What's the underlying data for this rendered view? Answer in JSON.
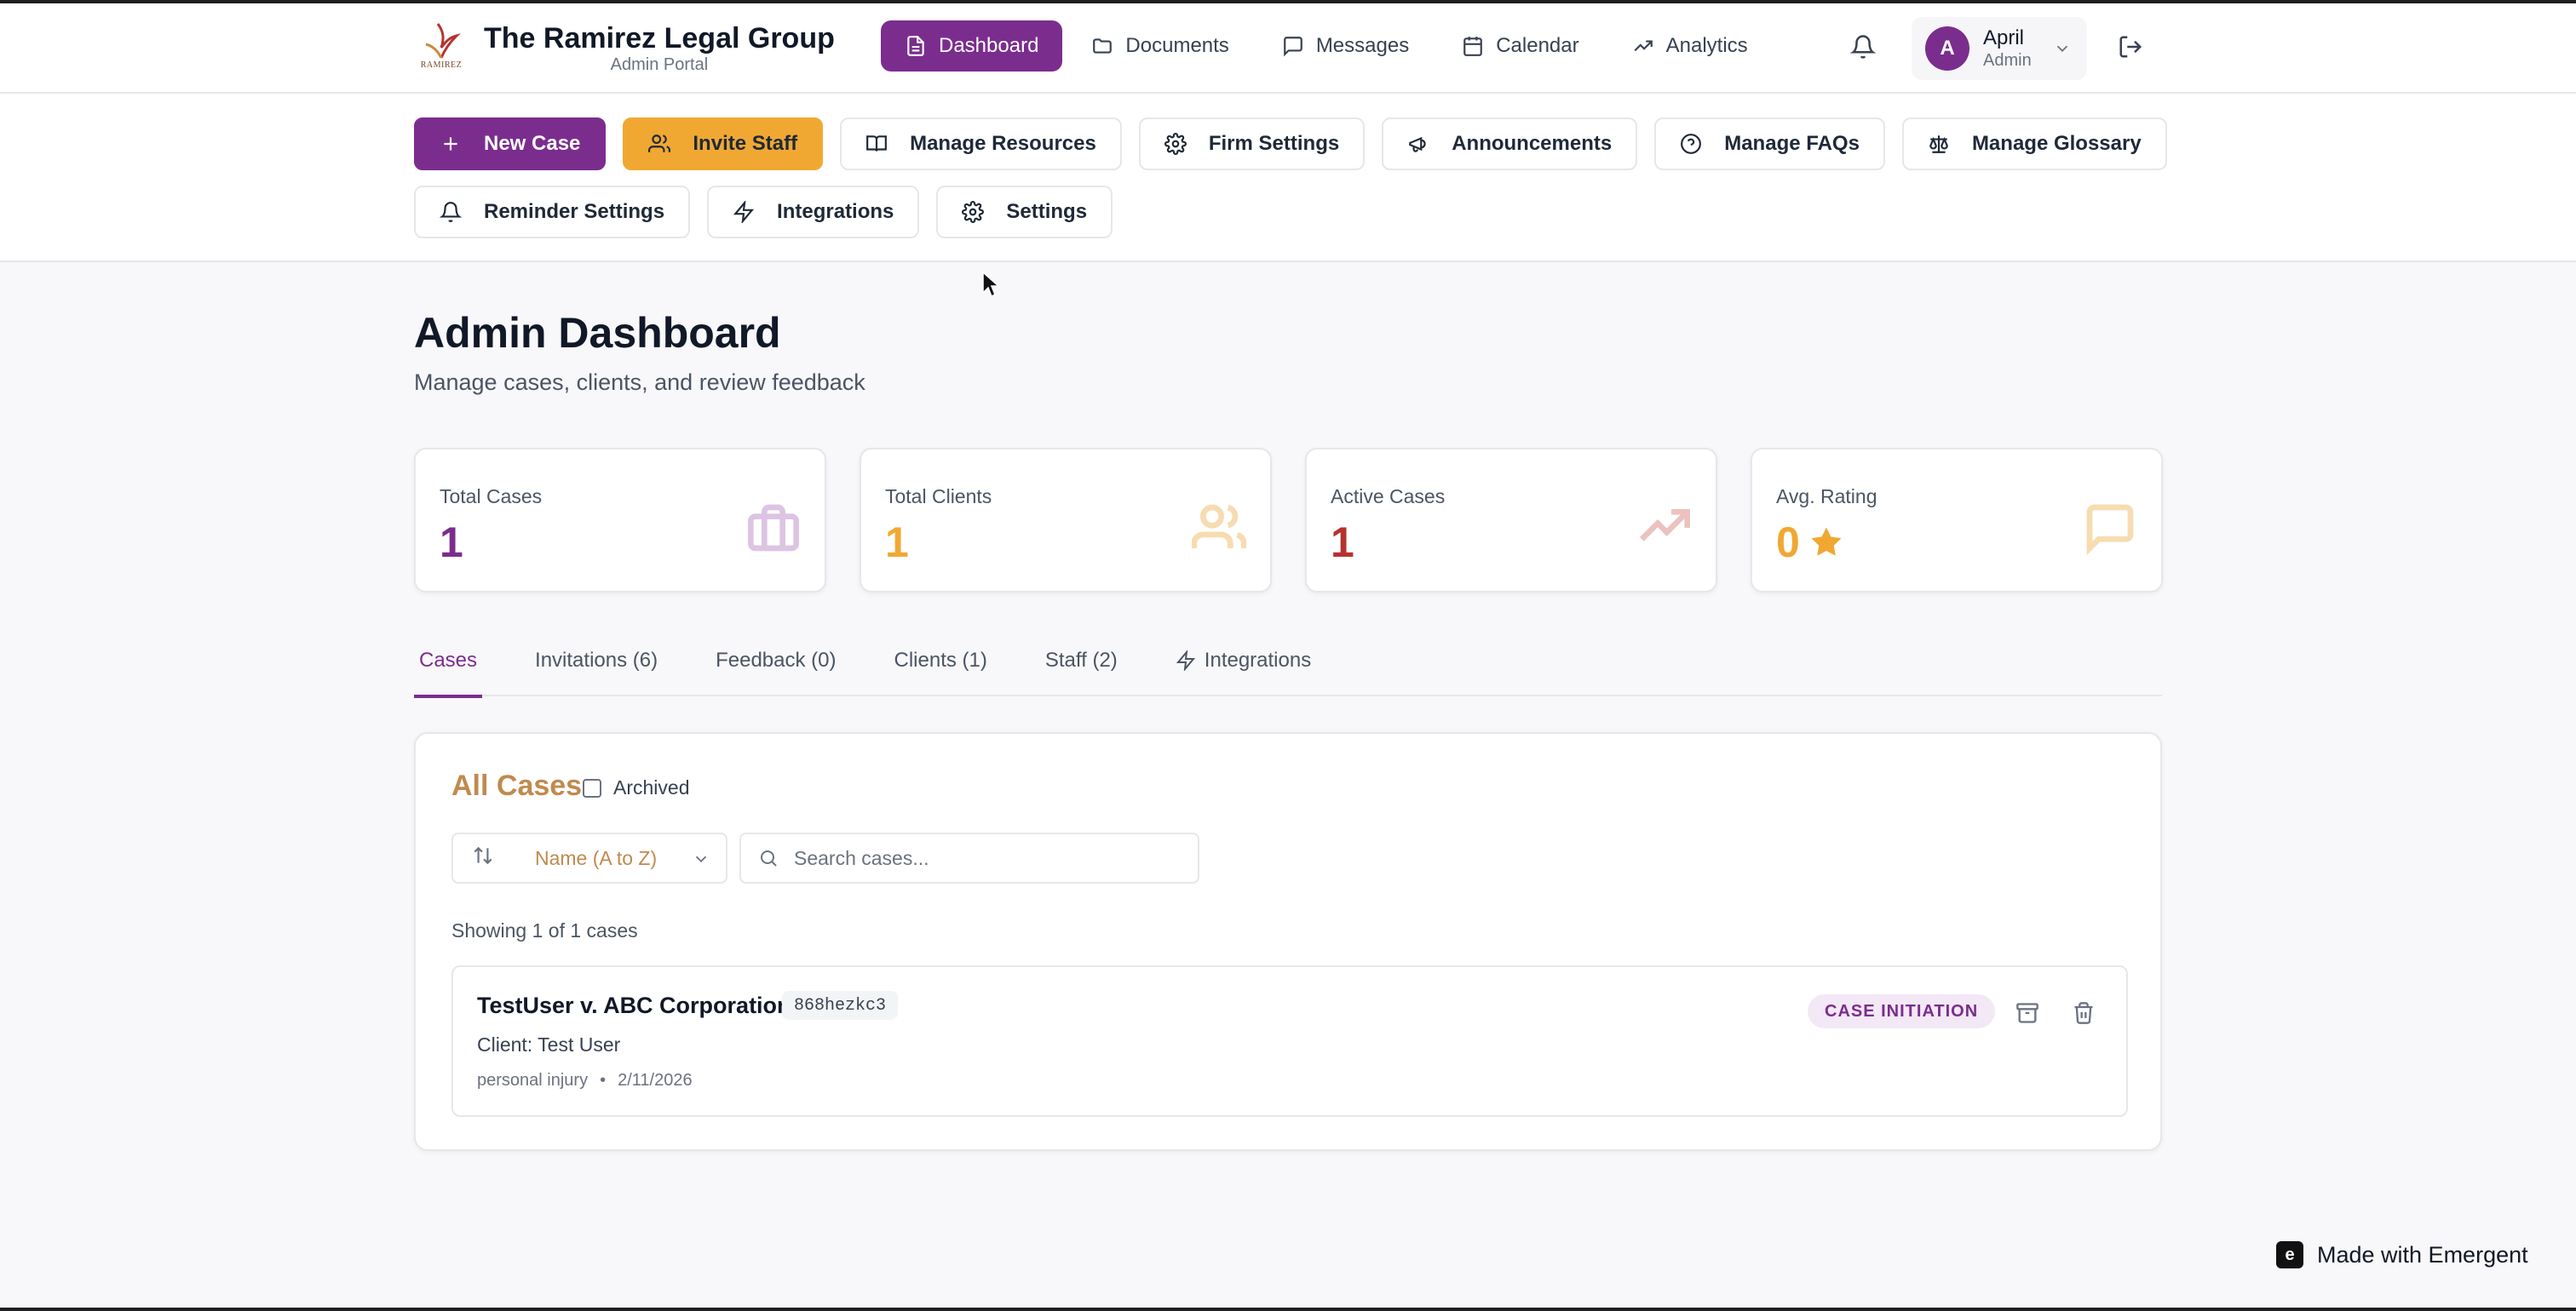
{
  "brand": {
    "title": "The Ramirez Legal Group",
    "subtitle": "Admin Portal",
    "logo_text": "RAMIREZ"
  },
  "nav": [
    {
      "label": "Dashboard",
      "icon": "document-icon",
      "active": true
    },
    {
      "label": "Documents",
      "icon": "folder-icon"
    },
    {
      "label": "Messages",
      "icon": "message-icon"
    },
    {
      "label": "Calendar",
      "icon": "calendar-icon"
    },
    {
      "label": "Analytics",
      "icon": "trending-up-icon"
    }
  ],
  "user": {
    "initial": "A",
    "name": "April",
    "role": "Admin"
  },
  "toolbar": {
    "row1": [
      {
        "label": "New Case",
        "icon": "plus-icon"
      },
      {
        "label": "Invite Staff",
        "icon": "users-icon"
      },
      {
        "label": "Manage Resources",
        "icon": "book-icon"
      },
      {
        "label": "Firm Settings",
        "icon": "gear-icon"
      },
      {
        "label": "Announcements",
        "icon": "megaphone-icon"
      },
      {
        "label": "Manage FAQs",
        "icon": "help-circle-icon"
      },
      {
        "label": "Manage Glossary",
        "icon": "scale-icon"
      }
    ],
    "row2": [
      {
        "label": "Reminder Settings",
        "icon": "bell-icon"
      },
      {
        "label": "Integrations",
        "icon": "zap-icon"
      },
      {
        "label": "Settings",
        "icon": "gear-icon"
      }
    ]
  },
  "page": {
    "title": "Admin Dashboard",
    "subtitle": "Manage cases, clients, and review feedback"
  },
  "stats": [
    {
      "label": "Total Cases",
      "value": "1",
      "color": "#7b2d8e",
      "icon": "briefcase-icon"
    },
    {
      "label": "Total Clients",
      "value": "1",
      "color": "#f0a833",
      "icon": "users-icon"
    },
    {
      "label": "Active Cases",
      "value": "1",
      "color": "#b5332e",
      "icon": "trending-up-icon"
    },
    {
      "label": "Avg. Rating",
      "value": "0",
      "color": "#f0a833",
      "icon": "message-square-icon"
    }
  ],
  "tabs": [
    {
      "label": "Cases",
      "active": true
    },
    {
      "label": "Invitations (6)"
    },
    {
      "label": "Feedback (0)"
    },
    {
      "label": "Clients (1)"
    },
    {
      "label": "Staff (2)"
    },
    {
      "label": "Integrations",
      "icon": "zap-icon"
    }
  ],
  "cases_panel": {
    "title": "All Cases",
    "archived_label": "Archived",
    "sort_label": "Name (A to Z)",
    "search_placeholder": "Search cases...",
    "showing": "Showing 1 of 1 cases",
    "items": [
      {
        "title": "TestUser v. ABC Corporation",
        "id": "868hezkc3",
        "client": "Client: Test User",
        "type": "personal injury",
        "date": "2/11/2026",
        "status": "CASE INITIATION"
      }
    ]
  },
  "footer": {
    "made_with": "Made with Emergent"
  },
  "colors": {
    "primary": "#7b2d8e",
    "accent": "#f0a833",
    "tan": "#c08a4e",
    "red": "#b5332e"
  }
}
